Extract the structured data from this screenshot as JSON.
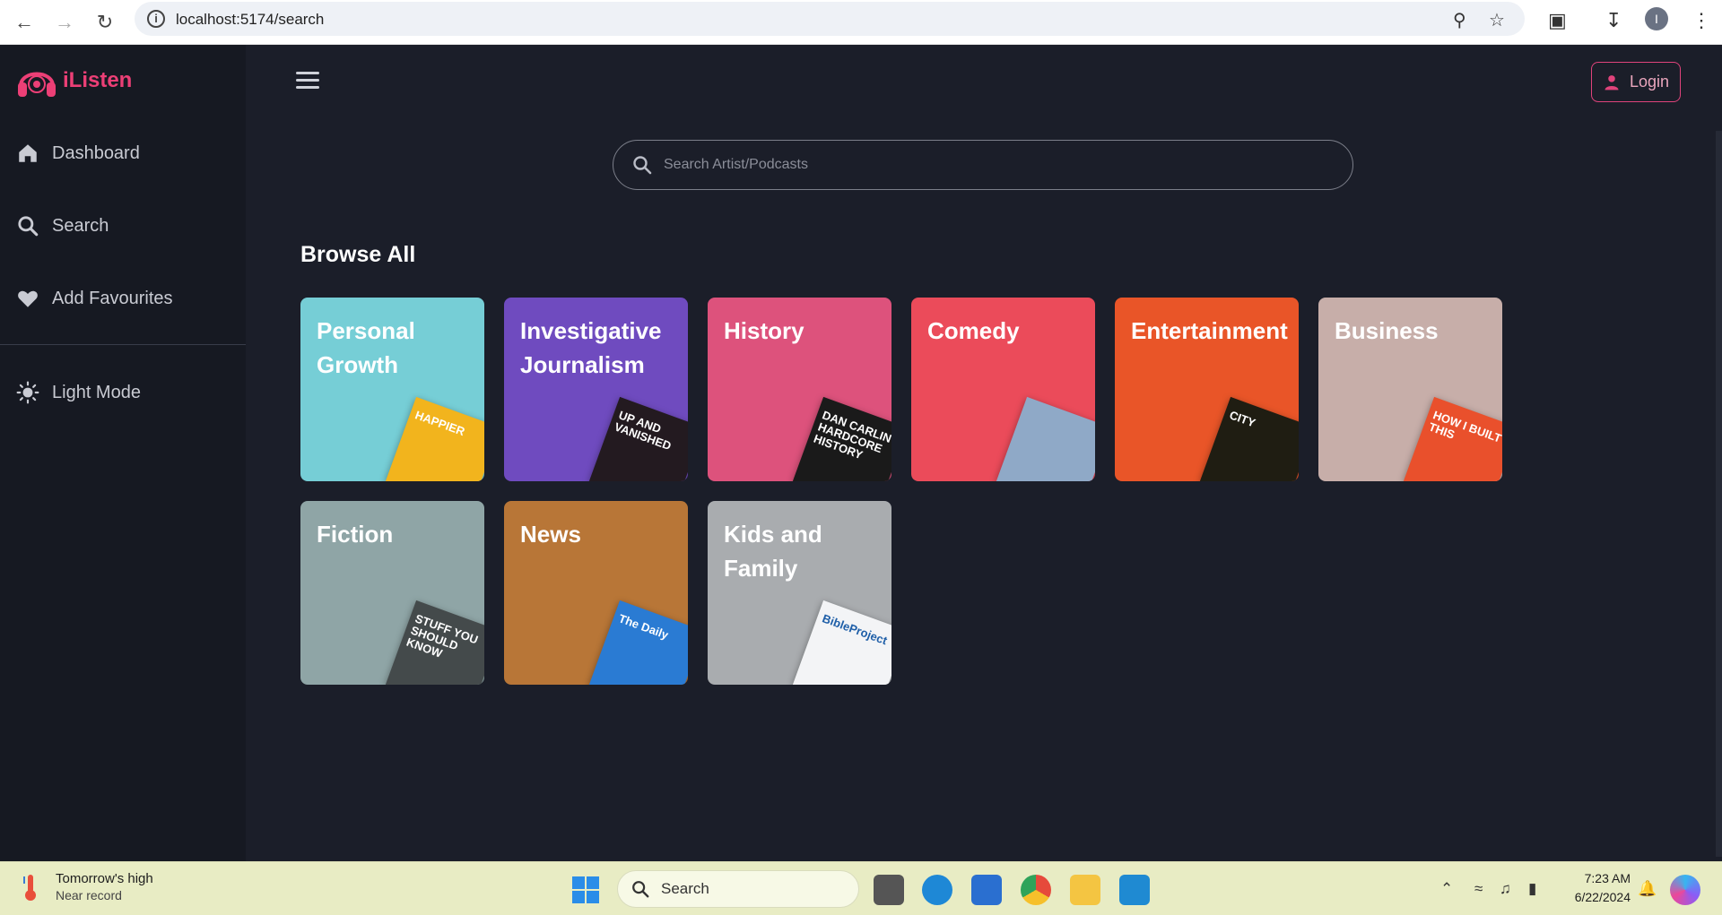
{
  "browser": {
    "url": "localhost:5174/search",
    "profile_initial": "I"
  },
  "app": {
    "name": "iListen",
    "brand_color": "#ec3f76"
  },
  "sidebar": {
    "items": [
      {
        "label": "Dashboard",
        "icon": "home-icon"
      },
      {
        "label": "Search",
        "icon": "search-icon"
      },
      {
        "label": "Add Favourites",
        "icon": "heart-icon"
      },
      {
        "label": "Light Mode",
        "icon": "sun-icon"
      }
    ]
  },
  "header": {
    "login_label": "Login"
  },
  "search": {
    "placeholder": "Search Artist/Podcasts"
  },
  "browse": {
    "title": "Browse All",
    "categories": [
      {
        "label": "Personal Growth",
        "color": "#76ced6",
        "art_color": "#f2b41d",
        "art_text": "HAPPIER"
      },
      {
        "label": "Investigative Journalism",
        "color": "#6f4bbf",
        "art_color": "#231a20",
        "art_text": "UP AND VANISHED"
      },
      {
        "label": "History",
        "color": "#dd527c",
        "art_color": "#1a1a1a",
        "art_text": "DAN CARLIN'S HARDCORE HISTORY"
      },
      {
        "label": "Comedy",
        "color": "#eb4b5a",
        "art_color": "#8fa9c7",
        "art_text": ""
      },
      {
        "label": "Entertainment",
        "color": "#e95528",
        "art_color": "#1f1d12",
        "art_text": "CITY"
      },
      {
        "label": "Business",
        "color": "#c7aea9",
        "art_color": "#e9502c",
        "art_text": "HOW I BUILT THIS"
      },
      {
        "label": "Fiction",
        "color": "#8fa5a6",
        "art_color": "#444a4b",
        "art_text": "STUFF YOU SHOULD KNOW"
      },
      {
        "label": "News",
        "color": "#b87637",
        "art_color": "#2a7bd3",
        "art_text": "The Daily"
      },
      {
        "label": "Kids and Family",
        "color": "#a9acaf",
        "art_color": "#f3f4f6",
        "art_text": "BibleProject"
      }
    ]
  },
  "taskbar": {
    "weather_line1": "Tomorrow's high",
    "weather_line2": "Near record",
    "search_label": "Search",
    "time": "7:23 AM",
    "date": "6/22/2024"
  }
}
